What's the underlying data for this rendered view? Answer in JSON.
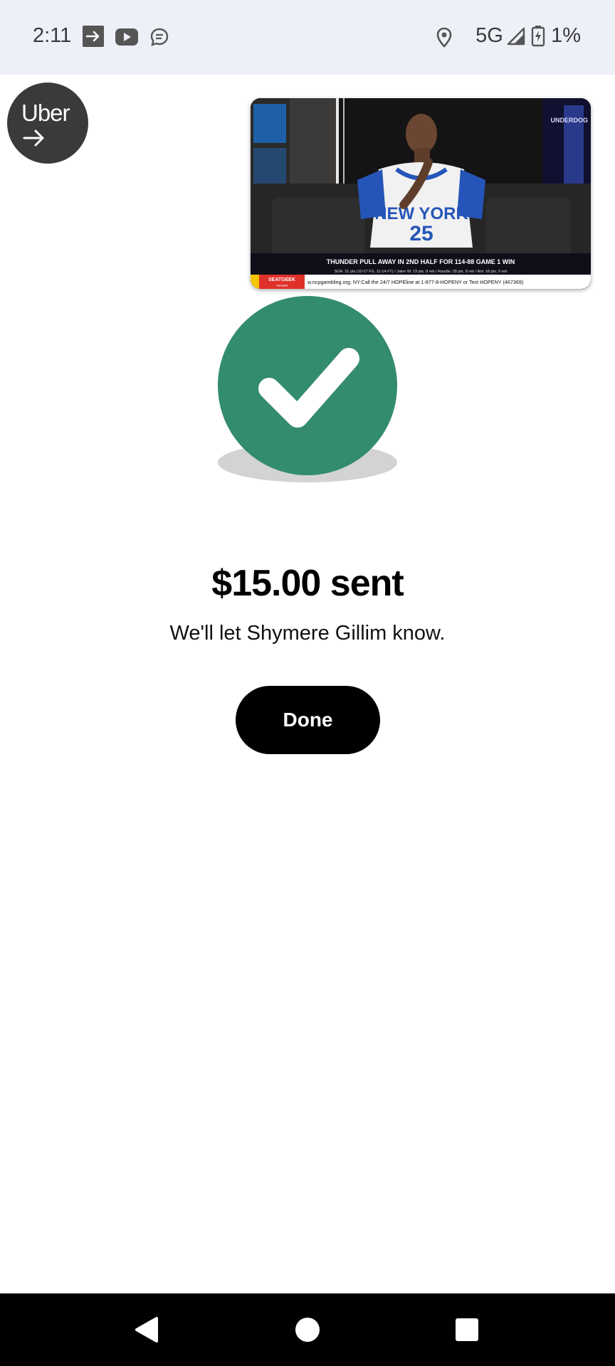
{
  "status_bar": {
    "time": "2:11",
    "network": "5G",
    "battery": "1%",
    "icons": [
      "forward-icon",
      "youtube-icon",
      "message-icon",
      "location-icon",
      "signal-icon",
      "battery-icon"
    ]
  },
  "uber_bubble": {
    "label": "Uber",
    "icon": "arrow-right-icon"
  },
  "video": {
    "jersey_text": "NEW YORK",
    "jersey_number": "25",
    "logo": "UNDERDOG",
    "headline": "THUNDER PULL AWAY IN 2ND HALF FOR 114-88 GAME 1 WIN",
    "stats_line": "SGA: 31 pts (10-27 FG, 11-14 FT) / Jalen W: 19 pts, 8 reb / Randle: 28 pts, 8 reb / Ant: 18 pts, 9 reb",
    "sponsor": "SEATGEEK",
    "sponsor_sub": "TICKER",
    "ticker": "w.ncpgambling.org; NY:Call the 24/7 HOPEline at 1-877-8-HOPENY or Text HOPENY (467369)"
  },
  "confirmation": {
    "amount_text": "$15.00 sent",
    "message": "We'll let Shymere Gillim know.",
    "done_label": "Done",
    "accent_color": "#338c6c"
  },
  "nav_bar": {
    "buttons": [
      "back-icon",
      "home-icon",
      "recents-icon"
    ]
  }
}
